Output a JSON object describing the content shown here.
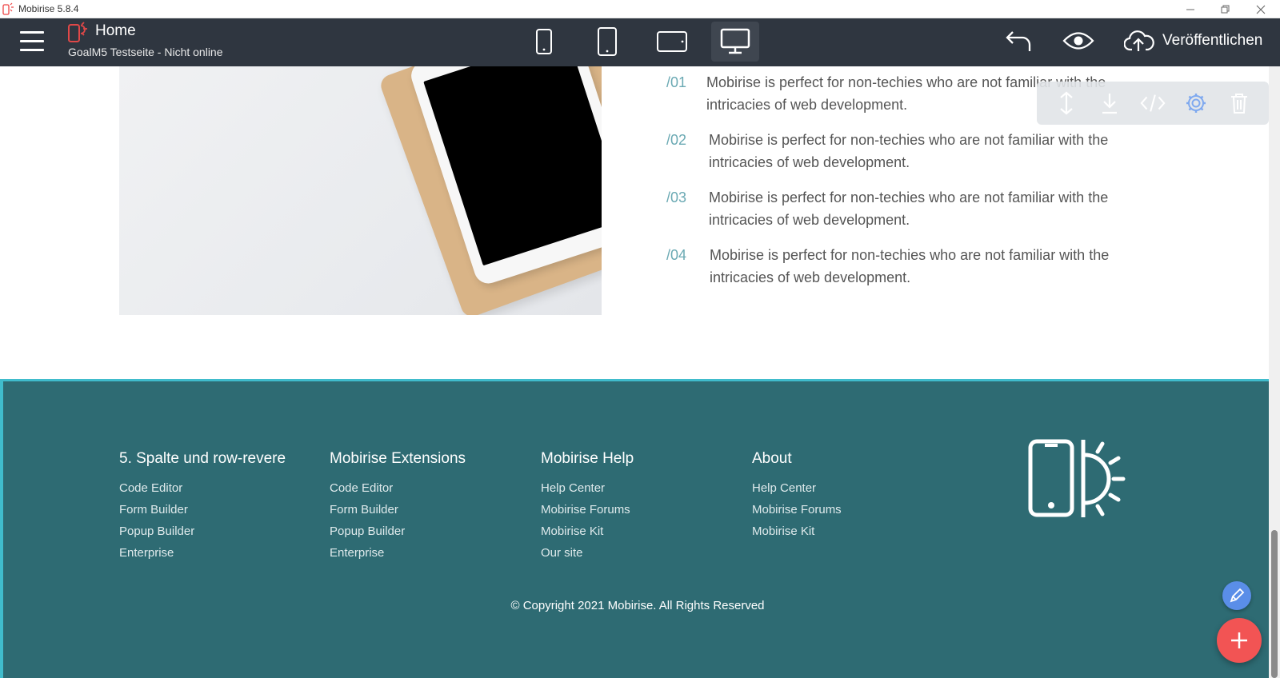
{
  "window": {
    "title": "Mobirise 5.8.4"
  },
  "appbar": {
    "page_title": "Home",
    "site_status": "GoalM5 Testseite - Nicht online",
    "publish_label": "Veröffentlichen"
  },
  "main": {
    "features": [
      {
        "num": "/01",
        "text": "Mobirise is perfect for non-techies who are not familiar with the intricacies of web development."
      },
      {
        "num": "/02",
        "text": "Mobirise is perfect for non-techies who are not familiar with the intricacies of web development."
      },
      {
        "num": "/03",
        "text": "Mobirise is perfect for non-techies who are not familiar with the intricacies of web development."
      },
      {
        "num": "/04",
        "text": "Mobirise is perfect for non-techies who are not familiar with the intricacies of web development."
      }
    ]
  },
  "footer": {
    "columns": [
      {
        "title": "5. Spalte und row-revere",
        "links": [
          "Code Editor",
          "Form Builder",
          "Popup Builder",
          "Enterprise"
        ]
      },
      {
        "title": "Mobirise Extensions",
        "links": [
          "Code Editor",
          "Form Builder",
          "Popup Builder",
          "Enterprise"
        ]
      },
      {
        "title": "Mobirise Help",
        "links": [
          "Help Center",
          "Mobirise Forums",
          "Mobirise Kit",
          "Our site"
        ]
      },
      {
        "title": "About",
        "links": [
          "Help Center",
          "Mobirise Forums",
          "Mobirise Kit"
        ]
      }
    ],
    "copyright": "© Copyright 2021 Mobirise. All Rights Reserved"
  },
  "colors": {
    "appbar": "#2f3640",
    "footer_bg": "#2e6b73",
    "accent_teal": "#40bccc",
    "number_color": "#6aa9b3",
    "fab_add": "#f25454",
    "fab_edit": "#5a8ee8"
  },
  "icons": [
    "menu-icon",
    "mobirise-logo-icon",
    "phone-small-icon",
    "phone-icon",
    "tablet-icon",
    "desktop-icon",
    "undo-icon",
    "preview-eye-icon",
    "cloud-upload-icon",
    "move-icon",
    "save-block-icon",
    "code-icon",
    "gear-icon",
    "trash-icon",
    "pencil-icon",
    "plus-icon"
  ]
}
